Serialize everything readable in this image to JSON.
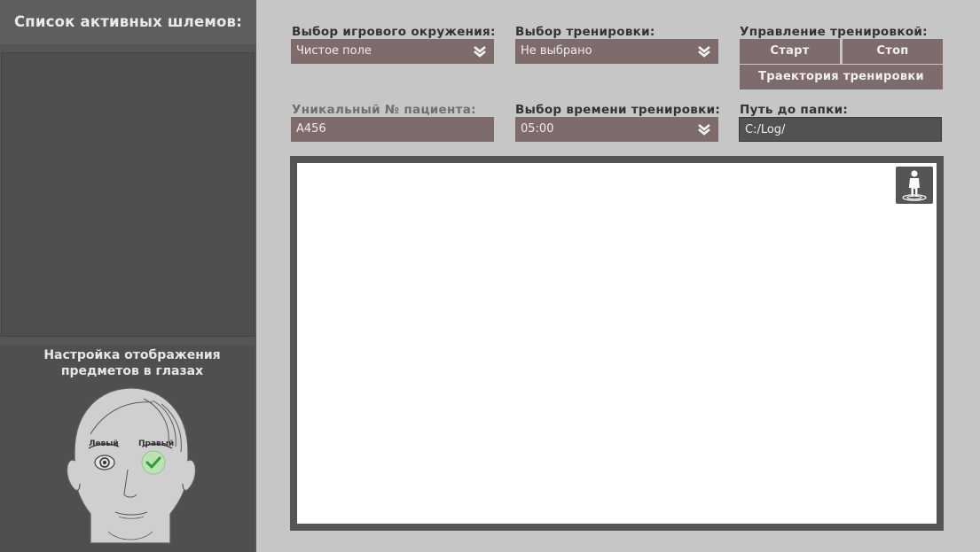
{
  "sidebar": {
    "title": "Список активных шлемов:",
    "eye_panel": {
      "title_line1": "Настройка отображения",
      "title_line2": "предметов в глазах",
      "left_label": "Левый",
      "right_label": "Правый"
    }
  },
  "environment": {
    "label": "Выбор игрового окружения:",
    "value": "Чистое поле"
  },
  "training": {
    "label": "Выбор тренировки:",
    "value": "Не выбрано"
  },
  "control": {
    "label": "Управление тренировкой:",
    "start": "Старт",
    "stop": "Стоп",
    "trajectory": "Траектория тренировки"
  },
  "patient": {
    "label": "Уникальный № пациента:",
    "value": "А456"
  },
  "time": {
    "label": "Выбор времени тренировки:",
    "value": "05:00"
  },
  "folder": {
    "label": "Путь до папки:",
    "value": "C:/Log/"
  },
  "icons": {
    "dropdown": "double-chevron-down-icon",
    "person": "person-icon",
    "check": "checkmark-icon"
  },
  "colors": {
    "accent": "#7e6b6b",
    "sidebar": "#565656",
    "background": "#c6c6c6"
  }
}
